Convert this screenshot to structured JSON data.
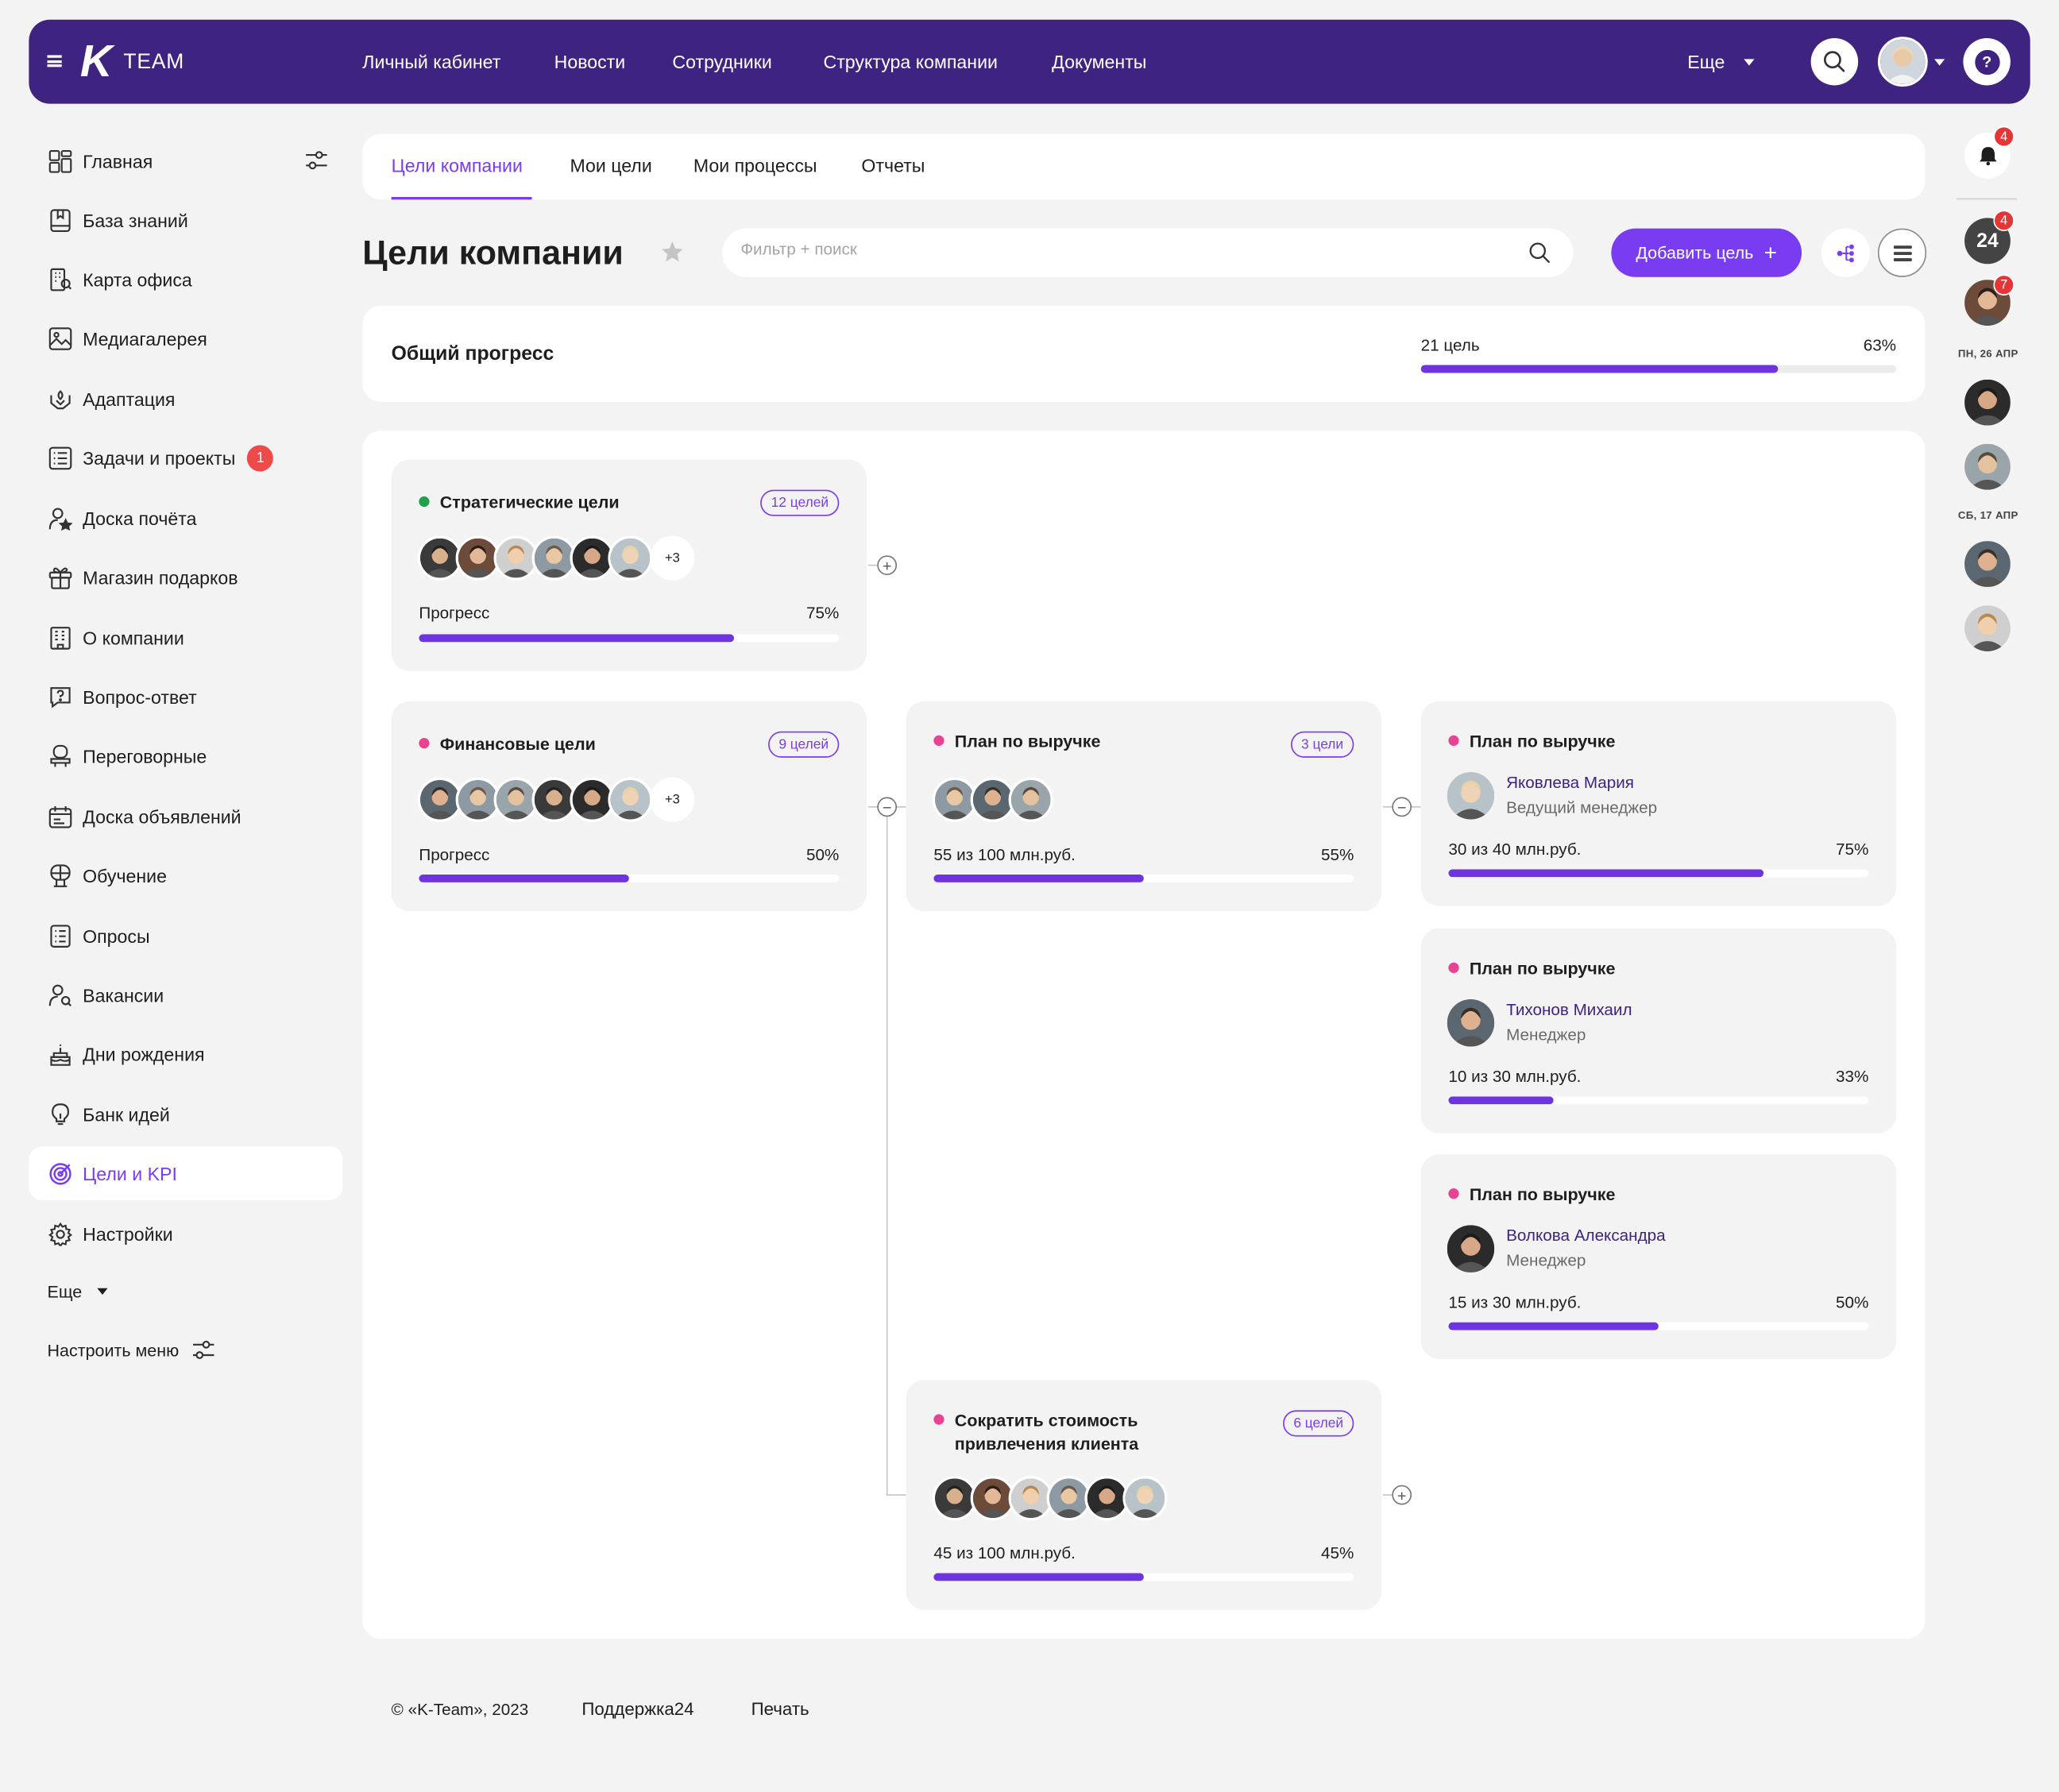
{
  "header": {
    "logo_k": "K",
    "logo_text": "TEAM",
    "nav": [
      "Личный кабинет",
      "Новости",
      "Сотрудники",
      "Структура компании",
      "Документы"
    ],
    "more_label": "Еще",
    "help_label": "?"
  },
  "sidebar": {
    "items": [
      {
        "label": "Главная",
        "icon": "dashboard-icon"
      },
      {
        "label": "База знаний",
        "icon": "book-icon"
      },
      {
        "label": "Карта офиса",
        "icon": "office-map-icon"
      },
      {
        "label": "Медиагалерея",
        "icon": "image-icon"
      },
      {
        "label": "Адаптация",
        "icon": "adaptation-icon"
      },
      {
        "label": "Задачи и проекты",
        "icon": "tasks-icon",
        "badge": "1"
      },
      {
        "label": "Доска почёта",
        "icon": "honor-board-icon"
      },
      {
        "label": "Магазин подарков",
        "icon": "gift-icon"
      },
      {
        "label": "О компании",
        "icon": "building-icon"
      },
      {
        "label": "Вопрос-ответ",
        "icon": "question-icon"
      },
      {
        "label": "Переговорные",
        "icon": "meeting-room-icon"
      },
      {
        "label": "Доска объявлений",
        "icon": "announcements-icon"
      },
      {
        "label": "Обучение",
        "icon": "learning-icon"
      },
      {
        "label": "Опросы",
        "icon": "survey-icon"
      },
      {
        "label": "Вакансии",
        "icon": "vacancy-icon"
      },
      {
        "label": "Дни рождения",
        "icon": "birthday-icon"
      },
      {
        "label": "Банк идей",
        "icon": "idea-icon"
      },
      {
        "label": "Цели и KPI",
        "icon": "target-icon",
        "active": true
      },
      {
        "label": "Настройки",
        "icon": "settings-icon"
      }
    ],
    "more_label": "Еще",
    "configure_label": "Настроить меню"
  },
  "tabs": [
    "Цели компании",
    "Мои цели",
    "Мои процессы",
    "Отчеты"
  ],
  "page": {
    "title": "Цели компании",
    "search_placeholder": "Фильтр + поиск",
    "add_button": "Добавить цель",
    "add_plus": "+"
  },
  "overall": {
    "label": "Общий прогресс",
    "count": "21 цель",
    "percent_label": "63%",
    "progress": 0.75
  },
  "goals": {
    "strategic": {
      "title": "Стратегические цели",
      "pill": "12 целей",
      "more": "+3",
      "progress_label": "Прогресс",
      "percent_label": "75%",
      "progress": 0.75,
      "dot": "#1fa24a"
    },
    "financial": {
      "title": "Финансовые цели",
      "pill": "9 целей",
      "more": "+3",
      "progress_label": "Прогресс",
      "percent_label": "50%",
      "progress": 0.5,
      "dot": "#e84393"
    },
    "revenue": {
      "title": "План по выручке",
      "pill": "3 цели",
      "progress_label": "55 из 100 млн.руб.",
      "percent_label": "55%",
      "progress": 0.5,
      "dot": "#e84393"
    },
    "cac": {
      "title_line1": "Сократить стоимость",
      "title_line2": "привлечения клиента",
      "pill": "6 целей",
      "progress_label": "45 из 100 млн.руб.",
      "percent_label": "45%",
      "progress": 0.5,
      "dot": "#e84393"
    },
    "people": [
      {
        "title": "План по выручке",
        "name": "Яковлева Мария",
        "role": "Ведущий менеджер",
        "progress_label": "30 из 40 млн.руб.",
        "percent_label": "75%",
        "progress": 0.75
      },
      {
        "title": "План по выручке",
        "name": "Тихонов Михаил",
        "role": "Менеджер",
        "progress_label": "10 из 30 млн.руб.",
        "percent_label": "33%",
        "progress": 0.25
      },
      {
        "title": "План по выручке",
        "name": "Волкова Александра",
        "role": "Менеджер",
        "progress_label": "15 из 30 млн.руб.",
        "percent_label": "50%",
        "progress": 0.5
      }
    ]
  },
  "right_rail": {
    "bell_badge": "4",
    "calendar_label": "24",
    "calendar_badge": "4",
    "avatar_badge": "7",
    "date1": "ПН, 26 АПР",
    "date2": "СБ, 17 АПР"
  },
  "footer": {
    "copyright": "© «K-Team», 2023",
    "support": "Поддержка24",
    "print": "Печать"
  },
  "colors": {
    "header": "#3f2381",
    "accent": "#7a3cf0",
    "progress": "#6d34e0",
    "badge": "#ef4a4a"
  }
}
